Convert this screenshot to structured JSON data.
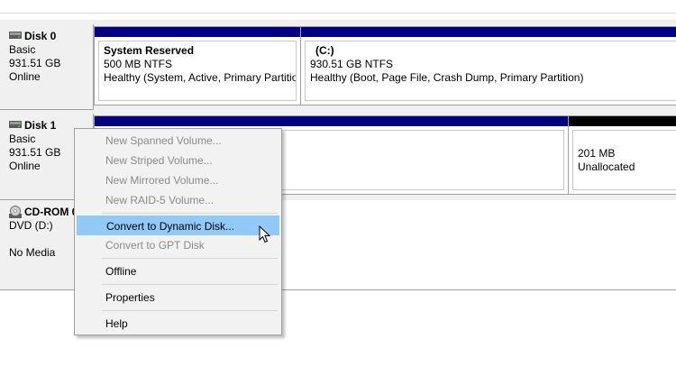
{
  "disks": [
    {
      "title": "Disk 0",
      "type": "Basic",
      "size": "931.51 GB",
      "status": "Online"
    },
    {
      "title": "Disk 1",
      "type": "Basic",
      "size": "931.51 GB",
      "status": "Online"
    },
    {
      "title": "CD-ROM 0",
      "type": "DVD (D:)",
      "status": "No Media"
    }
  ],
  "disk0_volumes": [
    {
      "name": "System Reserved",
      "fs": "500 MB NTFS",
      "health": "Healthy (System, Active, Primary Partitio"
    },
    {
      "name": "(C:)",
      "fs": "930.51 GB NTFS",
      "health": "Healthy (Boot, Page File, Crash Dump, Primary Partition)"
    }
  ],
  "disk1_unallocated": {
    "size": "201 MB",
    "label": "Unallocated"
  },
  "menu": {
    "items": [
      {
        "label": "New Spanned Volume...",
        "enabled": false
      },
      {
        "label": "New Striped Volume...",
        "enabled": false
      },
      {
        "label": "New Mirrored Volume...",
        "enabled": false
      },
      {
        "label": "New RAID-5 Volume...",
        "enabled": false
      },
      {
        "label": "Convert to Dynamic Disk...",
        "enabled": true,
        "highlighted": true
      },
      {
        "label": "Convert to GPT Disk",
        "enabled": false
      },
      {
        "label": "Offline",
        "enabled": true
      },
      {
        "label": "Properties",
        "enabled": true
      },
      {
        "label": "Help",
        "enabled": true
      }
    ]
  },
  "colors": {
    "primary_partition_bar": "#000080",
    "unallocated_bar": "#000000",
    "menu_highlight": "#91c9f7"
  },
  "icons": {
    "disk": "hard-disk-icon",
    "cdrom": "cd-rom-icon",
    "cursor": "mouse-pointer-icon"
  }
}
